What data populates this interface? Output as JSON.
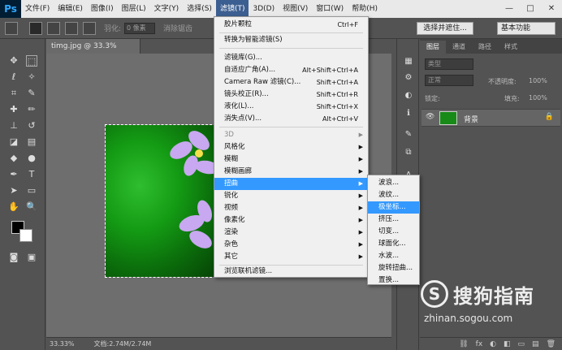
{
  "app": {
    "logo": "Ps"
  },
  "menubar": {
    "items": [
      "文件(F)",
      "编辑(E)",
      "图像(I)",
      "图层(L)",
      "文字(Y)",
      "选择(S)",
      "滤镜(T)",
      "3D(D)",
      "视图(V)",
      "窗口(W)",
      "帮助(H)"
    ],
    "active_index": 6,
    "win_min": "—",
    "win_max": "□",
    "win_close": "✕"
  },
  "options": {
    "feather_label": "羽化:",
    "feather_value": "0 像素",
    "antialias_label": "消除锯齿",
    "select_mask_label": "选择并遮住...",
    "workspace_label": "基本功能"
  },
  "document": {
    "tab_title": "timg.jpg @ 33.3%(RGB/8#) *",
    "tab_close": "×",
    "zoom": "33.33%",
    "doc_size": "文档:2.74M/2.74M"
  },
  "filter_menu": {
    "items": [
      {
        "label": "胶片颗粒",
        "shortcut": "Ctrl+F"
      },
      {
        "label": "转换为智能滤镜(S)"
      },
      {
        "label": "滤镜库(G)..."
      },
      {
        "label": "自适应广角(A)...",
        "shortcut": "Alt+Shift+Ctrl+A"
      },
      {
        "label": "Camera Raw 滤镜(C)...",
        "shortcut": "Shift+Ctrl+A"
      },
      {
        "label": "镜头校正(R)...",
        "shortcut": "Shift+Ctrl+R"
      },
      {
        "label": "液化(L)...",
        "shortcut": "Shift+Ctrl+X"
      },
      {
        "label": "消失点(V)...",
        "shortcut": "Alt+Ctrl+V"
      },
      {
        "label": "3D"
      },
      {
        "label": "风格化"
      },
      {
        "label": "模糊"
      },
      {
        "label": "模糊画廊"
      },
      {
        "label": "扭曲"
      },
      {
        "label": "锐化"
      },
      {
        "label": "视频"
      },
      {
        "label": "像素化"
      },
      {
        "label": "渲染"
      },
      {
        "label": "杂色"
      },
      {
        "label": "其它"
      },
      {
        "label": "浏览联机滤镜..."
      }
    ],
    "submenu_arrow": "▶"
  },
  "distort_submenu": {
    "items": [
      "波浪...",
      "波纹...",
      "极坐标...",
      "挤压...",
      "切变...",
      "球面化...",
      "水波...",
      "旋转扭曲...",
      "置换..."
    ],
    "highlighted_index": 2
  },
  "layers_panel": {
    "tabs": [
      "图层",
      "通道",
      "路径",
      "样式"
    ],
    "kind_label": "类型",
    "blend_mode": "正常",
    "opacity_label": "不透明度:",
    "opacity_value": "100%",
    "lock_label": "锁定:",
    "fill_label": "填充:",
    "fill_value": "100%",
    "layer_name": "背景",
    "footer_icons": [
      "⛓",
      "fx",
      "◐",
      "◧",
      "▭",
      "▤",
      "🗑"
    ]
  },
  "watermark": {
    "logo_glyph": "S",
    "title": "搜狗指南",
    "url": "zhinan.sogou.com"
  }
}
